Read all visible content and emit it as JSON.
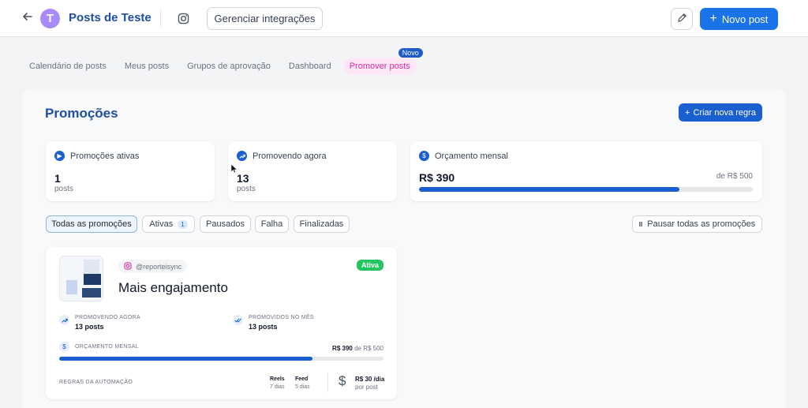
{
  "header": {
    "page_title": "Posts de Teste",
    "avatar_letter": "T",
    "manage_label": "Gerenciar integrações",
    "new_post_label": "Novo post"
  },
  "tabs": [
    {
      "label": "Calendário de posts"
    },
    {
      "label": "Meus posts"
    },
    {
      "label": "Grupos de aprovação"
    },
    {
      "label": "Dashboard"
    },
    {
      "label": "Promover posts",
      "badge": "Novo"
    }
  ],
  "promotions": {
    "title": "Promoções",
    "create_rule_label": "Criar nova regra",
    "stats": {
      "active": {
        "label": "Promoções ativas",
        "value": "1",
        "unit": "posts"
      },
      "promoting": {
        "label": "Promovendo agora",
        "value": "13",
        "unit": "posts"
      },
      "budget": {
        "label": "Orçamento mensal",
        "value": "R$ 390",
        "limit": "de R$ 500",
        "fraction": 0.78
      }
    },
    "filters": [
      {
        "label": "Todas as promoções"
      },
      {
        "label": "Ativas",
        "count": "1"
      },
      {
        "label": "Pausados"
      },
      {
        "label": "Falha"
      },
      {
        "label": "Finalizadas"
      }
    ],
    "pause_all_label": "Pausar todas as promoções",
    "card": {
      "account": "@reporteisync",
      "status": "Ativa",
      "title": "Mais engajamento",
      "promoting_label": "Promovendo agora",
      "promoting_value": "13 posts",
      "promoted_label": "Promovidos no mês",
      "promoted_value": "13 posts",
      "budget_label": "Orçamento mensal",
      "budget_value": "R$ 390",
      "budget_limit": "de R$ 500",
      "budget_fraction": 0.78,
      "rules_label": "Regras da automação",
      "reels_label": "Reels",
      "reels_days": "7 dias",
      "feed_label": "Feed",
      "feed_days": "5 dias",
      "price": "R$ 30 /dia",
      "price_sub": "por post"
    }
  },
  "colors": {
    "primary": "#1a73e8",
    "title_blue": "#1e4fa3",
    "active_tab": "#db2ea0",
    "status_green": "#22c55e"
  }
}
